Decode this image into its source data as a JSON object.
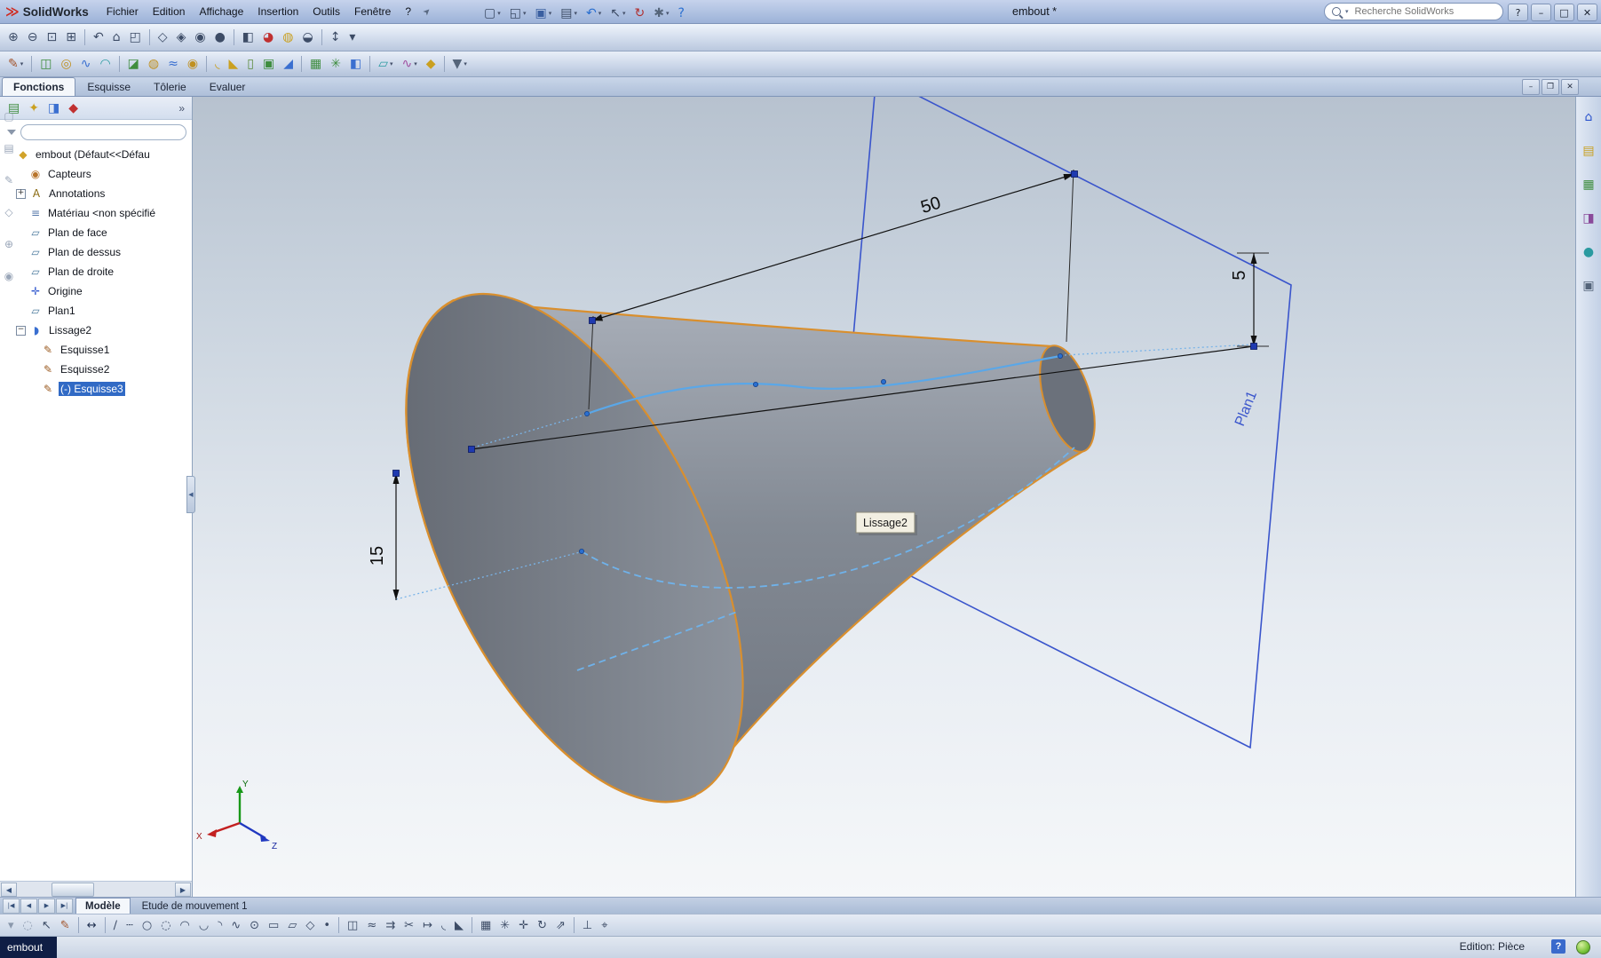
{
  "colors": {
    "edge_highlight": "#d98f2e",
    "selection_blue": "#316ac5",
    "plane_blue": "#3a55cc",
    "spline_blue": "#5aa7e8"
  },
  "window": {
    "app_name": "SolidWorks",
    "document_title": "embout *",
    "search_placeholder": "Recherche SolidWorks",
    "controls": {
      "help": "?",
      "minimize": "–",
      "maximize": "□",
      "close": "✕"
    }
  },
  "menubar": {
    "items": [
      "Fichier",
      "Edition",
      "Affichage",
      "Insertion",
      "Outils",
      "Fenêtre",
      "?"
    ]
  },
  "title_toolbar": {
    "icons": [
      {
        "name": "new-document-icon",
        "glyph": "▢",
        "caret": true
      },
      {
        "name": "open-document-icon",
        "glyph": "◱",
        "caret": true
      },
      {
        "name": "save-icon",
        "glyph": "▣",
        "color": "#3a5fa0",
        "caret": true
      },
      {
        "name": "print-icon",
        "glyph": "▤",
        "caret": true
      },
      {
        "name": "undo-icon",
        "glyph": "↶",
        "color": "#2a6fd0",
        "caret": true
      },
      {
        "name": "select-icon",
        "glyph": "↖",
        "caret": true
      },
      {
        "name": "rebuild-icon",
        "glyph": "↻",
        "color": "#b03030"
      },
      {
        "name": "options-icon",
        "glyph": "✱",
        "color": "#55657a",
        "caret": true
      },
      {
        "name": "help-icon",
        "glyph": "?",
        "color": "#2a6fd0"
      }
    ]
  },
  "view_toolbar": {
    "icons": [
      {
        "name": "zoom-in-icon",
        "glyph": "⊕"
      },
      {
        "name": "zoom-out-icon",
        "glyph": "⊖"
      },
      {
        "name": "zoom-to-fit-icon",
        "glyph": "⊡"
      },
      {
        "name": "zoom-to-area-icon",
        "glyph": "⊞"
      },
      {
        "sep": true
      },
      {
        "name": "previous-view-icon",
        "glyph": "↶"
      },
      {
        "name": "named-views-icon",
        "glyph": "⌂"
      },
      {
        "name": "view-orientation-icon",
        "glyph": "◰"
      },
      {
        "sep": true
      },
      {
        "name": "wireframe-icon",
        "glyph": "◇"
      },
      {
        "name": "hidden-lines-icon",
        "glyph": "◈"
      },
      {
        "name": "shaded-edges-icon",
        "glyph": "◉"
      },
      {
        "name": "shaded-icon",
        "glyph": "●"
      },
      {
        "sep": true
      },
      {
        "name": "section-view-icon",
        "glyph": "◧"
      },
      {
        "name": "appearance-icon",
        "glyph": "◕",
        "color": "#c03030"
      },
      {
        "name": "scene-icon",
        "glyph": "◍",
        "color": "#caa020"
      },
      {
        "name": "shadows-icon",
        "glyph": "◒"
      },
      {
        "sep": true
      },
      {
        "name": "temporary-axes-icon",
        "glyph": "↕"
      },
      {
        "name": "view-settings-icon",
        "glyph": "▾"
      }
    ]
  },
  "features_toolbar": {
    "icons": [
      {
        "name": "sketch-icon",
        "glyph": "✎",
        "color": "#a2542c",
        "caret": true
      },
      {
        "sep": true
      },
      {
        "name": "extrude-boss-icon",
        "glyph": "◫",
        "color": "#3f8d3f"
      },
      {
        "name": "revolve-boss-icon",
        "glyph": "◎",
        "color": "#c09020"
      },
      {
        "name": "swept-boss-icon",
        "glyph": "∿",
        "color": "#3a6fd0"
      },
      {
        "name": "loft-boss-icon",
        "glyph": "◠",
        "color": "#2a9aa0"
      },
      {
        "sep": true
      },
      {
        "name": "extrude-cut-icon",
        "glyph": "◪",
        "color": "#3f8d3f"
      },
      {
        "name": "revolve-cut-icon",
        "glyph": "◍",
        "color": "#c09020"
      },
      {
        "name": "swept-cut-icon",
        "glyph": "≈",
        "color": "#3a6fd0"
      },
      {
        "name": "hole-wizard-icon",
        "glyph": "◉",
        "color": "#c09020"
      },
      {
        "sep": true
      },
      {
        "name": "fillet-icon",
        "glyph": "◟",
        "color": "#caa020"
      },
      {
        "name": "chamfer-icon",
        "glyph": "◣",
        "color": "#caa020"
      },
      {
        "name": "rib-icon",
        "glyph": "▯",
        "color": "#5a8a3a"
      },
      {
        "name": "shell-icon",
        "glyph": "▣",
        "color": "#3f8d3f"
      },
      {
        "name": "draft-icon",
        "glyph": "◢",
        "color": "#3a6fd0"
      },
      {
        "sep": true
      },
      {
        "name": "linear-pattern-icon",
        "glyph": "▦",
        "color": "#3f8d3f"
      },
      {
        "name": "circular-pattern-icon",
        "glyph": "✳",
        "color": "#3f8d3f"
      },
      {
        "name": "mirror-icon",
        "glyph": "◧",
        "color": "#3a6fd0"
      },
      {
        "sep": true
      },
      {
        "name": "reference-geometry-icon",
        "glyph": "▱",
        "color": "#2a9aa0",
        "caret": true
      },
      {
        "name": "curves-icon",
        "glyph": "∿",
        "color": "#a050a0",
        "caret": true
      },
      {
        "name": "instant3d-icon",
        "glyph": "◆",
        "color": "#caa020"
      },
      {
        "sep": true
      },
      {
        "name": "selection-filter-icon",
        "glyph": "▼",
        "color": "#55657a",
        "caret": true
      }
    ]
  },
  "command_tabs": {
    "items": [
      {
        "label": "Fonctions",
        "active": true
      },
      {
        "label": "Esquisse",
        "active": false
      },
      {
        "label": "Tôlerie",
        "active": false
      },
      {
        "label": "Evaluer",
        "active": false
      }
    ]
  },
  "doc_window_controls": {
    "minimize": "–",
    "restore": "❐",
    "close": "✕"
  },
  "feature_manager": {
    "header_icons": [
      {
        "name": "featuremanager-tree-icon",
        "glyph": "▤",
        "color": "#3f8d3f"
      },
      {
        "name": "propertymanager-icon",
        "glyph": "✦",
        "color": "#caa020"
      },
      {
        "name": "configurationmanager-icon",
        "glyph": "◨",
        "color": "#3a6fd0"
      },
      {
        "name": "dimxpertmanager-icon",
        "glyph": "◆",
        "color": "#c03030"
      }
    ],
    "overflow": "»",
    "filter_placeholder": "",
    "tree": {
      "icon_map": {
        "part": {
          "glyph": "◆",
          "color": "#d1a32a"
        },
        "sensors": {
          "glyph": "◉",
          "color": "#b8742a"
        },
        "annotations": {
          "glyph": "A",
          "color": "#8a6a10"
        },
        "material": {
          "glyph": "≡",
          "color": "#5577aa"
        },
        "plane": {
          "glyph": "▱",
          "color": "#49789c"
        },
        "origin": {
          "glyph": "✛",
          "color": "#2a52cc"
        },
        "loft": {
          "glyph": "◗",
          "color": "#3a6fd0"
        },
        "sketch": {
          "glyph": "✎",
          "color": "#9a5a20"
        }
      },
      "items": [
        {
          "label": "embout (Défaut<<Défau",
          "icon": "part",
          "indent": 0
        },
        {
          "label": "Capteurs",
          "icon": "sensors",
          "indent": 1
        },
        {
          "label": "Annotations",
          "icon": "annotations",
          "indent": 1,
          "expander": "plus"
        },
        {
          "label": "Matériau <non spécifié",
          "icon": "material",
          "indent": 1
        },
        {
          "label": "Plan de face",
          "icon": "plane",
          "indent": 1
        },
        {
          "label": "Plan de dessus",
          "icon": "plane",
          "indent": 1
        },
        {
          "label": "Plan de droite",
          "icon": "plane",
          "indent": 1
        },
        {
          "label": "Origine",
          "icon": "origin",
          "indent": 1
        },
        {
          "label": "Plan1",
          "icon": "plane",
          "indent": 1
        },
        {
          "label": "Lissage2",
          "icon": "loft",
          "indent": 1,
          "expander": "minus"
        },
        {
          "label": "Esquisse1",
          "icon": "sketch",
          "indent": 2
        },
        {
          "label": "Esquisse2",
          "icon": "sketch",
          "indent": 2
        },
        {
          "label": "(-) Esquisse3",
          "icon": "sketch",
          "indent": 2,
          "selected": true
        }
      ]
    }
  },
  "left_edge_icons": [
    {
      "name": "docked-toolbar-icon-1",
      "glyph": "▢",
      "color": "#9aa6b8"
    },
    {
      "name": "docked-toolbar-icon-2",
      "glyph": "▤",
      "color": "#9aa6b8"
    },
    {
      "name": "docked-toolbar-icon-3",
      "glyph": "✎",
      "color": "#9aa6b8"
    },
    {
      "name": "docked-toolbar-icon-4",
      "glyph": "◇",
      "color": "#9aa6b8"
    },
    {
      "name": "docked-toolbar-icon-5",
      "glyph": "⊕",
      "color": "#9aa6b8"
    },
    {
      "name": "docked-toolbar-icon-6",
      "glyph": "◉",
      "color": "#9aa6b8"
    }
  ],
  "viewport": {
    "dimensions": {
      "d50": "50",
      "d15": "15",
      "d5": "5"
    },
    "plane_label": "Plan1",
    "tooltip": "Lissage2",
    "triad": {
      "x": "X",
      "y": "Y",
      "z": "Z"
    }
  },
  "task_pane": {
    "icons": [
      {
        "name": "solidworks-resources-icon",
        "glyph": "⌂",
        "color": "#2a52cc"
      },
      {
        "name": "design-library-icon",
        "glyph": "▤",
        "color": "#c8a020"
      },
      {
        "name": "file-explorer-icon",
        "glyph": "▦",
        "color": "#3f8d3f"
      },
      {
        "name": "view-palette-icon",
        "glyph": "◨",
        "color": "#8a4a9a"
      },
      {
        "name": "appearances-icon",
        "glyph": "●",
        "color": "#2a9aa0"
      },
      {
        "name": "custom-properties-icon",
        "glyph": "▣",
        "color": "#55657a"
      }
    ]
  },
  "bottom_tabs": {
    "nav": [
      "|◀",
      "◀",
      "▶",
      "▶|"
    ],
    "items": [
      {
        "label": "Modèle",
        "active": true
      },
      {
        "label": "Etude de mouvement 1",
        "active": false
      }
    ]
  },
  "sketch_toolbar": {
    "icons": [
      {
        "name": "toolbar-flyout-icon",
        "glyph": "▾",
        "color": "#8a98ac"
      },
      {
        "name": "lasso-select-icon",
        "glyph": "◌",
        "color": "#8a98ac"
      },
      {
        "name": "select-icon",
        "glyph": "↖"
      },
      {
        "name": "sketch-icon",
        "glyph": "✎",
        "color": "#a2542c"
      },
      {
        "sep": true
      },
      {
        "name": "smart-dimension-icon",
        "glyph": "↔",
        "color": "#203050"
      },
      {
        "sep": true
      },
      {
        "name": "line-icon",
        "glyph": "∕"
      },
      {
        "name": "centerline-icon",
        "glyph": "┄"
      },
      {
        "name": "circle-icon",
        "glyph": "○"
      },
      {
        "name": "perimeter-circle-icon",
        "glyph": "◌"
      },
      {
        "name": "centerpoint-arc-icon",
        "glyph": "◠"
      },
      {
        "name": "tangent-arc-icon",
        "glyph": "◡"
      },
      {
        "name": "three-point-arc-icon",
        "glyph": "◝"
      },
      {
        "name": "spline-icon",
        "glyph": "∿"
      },
      {
        "name": "ellipse-icon",
        "glyph": "⊙"
      },
      {
        "name": "rectangle-icon",
        "glyph": "▭"
      },
      {
        "name": "parallelogram-icon",
        "glyph": "▱"
      },
      {
        "name": "polygon-icon",
        "glyph": "◇"
      },
      {
        "name": "point-icon",
        "glyph": "•"
      },
      {
        "sep": true
      },
      {
        "name": "mirror-entities-icon",
        "glyph": "◫"
      },
      {
        "name": "offset-entities-icon",
        "glyph": "≈"
      },
      {
        "name": "convert-entities-icon",
        "glyph": "⇉"
      },
      {
        "name": "trim-entities-icon",
        "glyph": "✂"
      },
      {
        "name": "extend-entities-icon",
        "glyph": "↦"
      },
      {
        "name": "sketch-fillet-icon",
        "glyph": "◟"
      },
      {
        "name": "sketch-chamfer-icon",
        "glyph": "◣"
      },
      {
        "sep": true
      },
      {
        "name": "linear-sketch-pattern-icon",
        "glyph": "▦"
      },
      {
        "name": "circular-sketch-pattern-icon",
        "glyph": "✳"
      },
      {
        "name": "move-entities-icon",
        "glyph": "✛"
      },
      {
        "name": "rotate-entities-icon",
        "glyph": "↻"
      },
      {
        "name": "scale-entities-icon",
        "glyph": "⇗"
      },
      {
        "sep": true
      },
      {
        "name": "display-relations-icon",
        "glyph": "⊥"
      },
      {
        "name": "quick-snaps-icon",
        "glyph": "⌖"
      }
    ]
  },
  "status_bar": {
    "selected": "embout",
    "mode": "Edition: Pièce",
    "help": "?"
  }
}
